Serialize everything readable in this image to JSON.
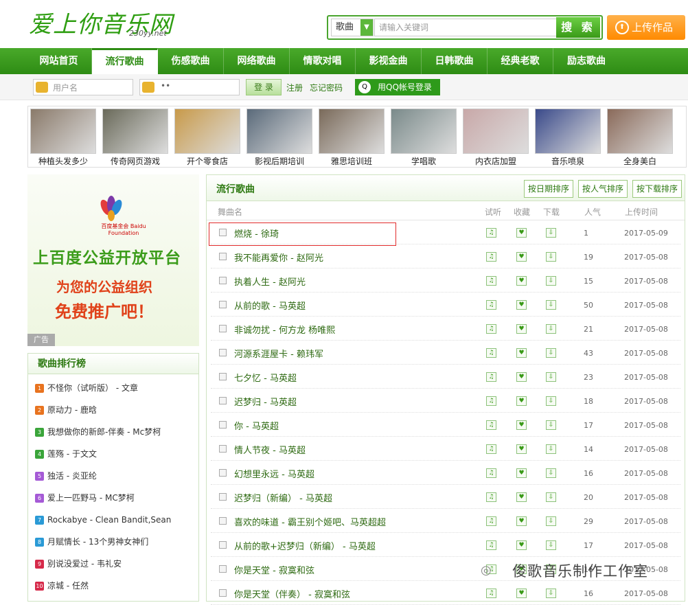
{
  "header": {
    "logo": "爱上你音乐网",
    "logo_sub": "230yy.net",
    "search_category": "歌曲",
    "search_placeholder": "请输入关键词",
    "search_button": "搜 索",
    "upload_button": "上传作品"
  },
  "nav": [
    "网站首页",
    "流行歌曲",
    "伤感歌曲",
    "网络歌曲",
    "情歌对唱",
    "影视金曲",
    "日韩歌曲",
    "经典老歌",
    "励志歌曲"
  ],
  "login": {
    "username_placeholder": "用户名",
    "password_value": "••",
    "login_button": "登 录",
    "register": "注册",
    "forgot": "忘记密码",
    "qq_login": "用QQ帐号登录"
  },
  "ads": [
    "种植头发多少",
    "传奇网页游戏",
    "开个零食店",
    "影视后期培训",
    "雅思培训班",
    "学唱歌",
    "内衣店加盟",
    "音乐喷泉",
    "全身美白"
  ],
  "left_ad": {
    "org": "百度基金会 Baidu Foundation",
    "line1": "上百度公益开放平台",
    "line2": "为您的公益组织",
    "line3": "免费推广吧！",
    "tag": "广告"
  },
  "ranking": {
    "title": "歌曲排行榜",
    "items": [
      {
        "num": "1",
        "color": "#e8731f",
        "text": "不怪你（试听版） - 文章"
      },
      {
        "num": "2",
        "color": "#e8731f",
        "text": "原动力 - 鹿晗"
      },
      {
        "num": "3",
        "color": "#3aa53a",
        "text": "我想做你的新郎-伴奏 - Mc梦柯"
      },
      {
        "num": "4",
        "color": "#3aa53a",
        "text": "莲殇 - 于文文"
      },
      {
        "num": "5",
        "color": "#a55ad6",
        "text": "独活 - 炎亚纶"
      },
      {
        "num": "6",
        "color": "#a55ad6",
        "text": "爱上一匹野马 - MC梦柯"
      },
      {
        "num": "7",
        "color": "#2a9ad6",
        "text": "Rockabye - Clean Bandit,Sean"
      },
      {
        "num": "8",
        "color": "#2a9ad6",
        "text": "月赋情长 - 13个男神女神们"
      },
      {
        "num": "9",
        "color": "#d62a4a",
        "text": "别说没爱过 - 韦礼安"
      },
      {
        "num": "10",
        "color": "#d62a4a",
        "text": "凉城 - 任然"
      }
    ]
  },
  "main": {
    "title": "流行歌曲",
    "sort_buttons": [
      "按日期排序",
      "按人气排序",
      "按下载排序"
    ],
    "columns": [
      "舞曲名",
      "试听",
      "收藏",
      "下载",
      "人气",
      "上传时间"
    ],
    "songs": [
      {
        "name": "燃烧 - 徐琦",
        "pop": "1",
        "date": "2017-05-09"
      },
      {
        "name": "我不能再爱你 - 赵阿光",
        "pop": "19",
        "date": "2017-05-08"
      },
      {
        "name": "执着人生 - 赵阿光",
        "pop": "15",
        "date": "2017-05-08"
      },
      {
        "name": "从前的歌 - 马英超",
        "pop": "50",
        "date": "2017-05-08"
      },
      {
        "name": "非诚勿扰 - 何方龙 杨唯熙",
        "pop": "21",
        "date": "2017-05-08"
      },
      {
        "name": "河源系涯屋卡 - 赖玮军",
        "pop": "43",
        "date": "2017-05-08"
      },
      {
        "name": "七夕忆 - 马英超",
        "pop": "23",
        "date": "2017-05-08"
      },
      {
        "name": "迟梦归 - 马英超",
        "pop": "18",
        "date": "2017-05-08"
      },
      {
        "name": "你 - 马英超",
        "pop": "17",
        "date": "2017-05-08"
      },
      {
        "name": "情人节夜 - 马英超",
        "pop": "14",
        "date": "2017-05-08"
      },
      {
        "name": "幻想里永远 - 马英超",
        "pop": "16",
        "date": "2017-05-08"
      },
      {
        "name": "迟梦归（新编） - 马英超",
        "pop": "20",
        "date": "2017-05-08"
      },
      {
        "name": "喜欢的味道 - 霸王别个姬吧、马英超超",
        "pop": "29",
        "date": "2017-05-08"
      },
      {
        "name": "从前的歌+迟梦归（新编） - 马英超",
        "pop": "17",
        "date": "2017-05-08"
      },
      {
        "name": "你是天堂 - 寂寞和弦",
        "pop": "16",
        "date": "2017-05-08"
      },
      {
        "name": "你是天堂（伴奏） - 寂寞和弦",
        "pop": "16",
        "date": "2017-05-08"
      }
    ]
  },
  "watermark": "俊歌音乐制作工作室"
}
